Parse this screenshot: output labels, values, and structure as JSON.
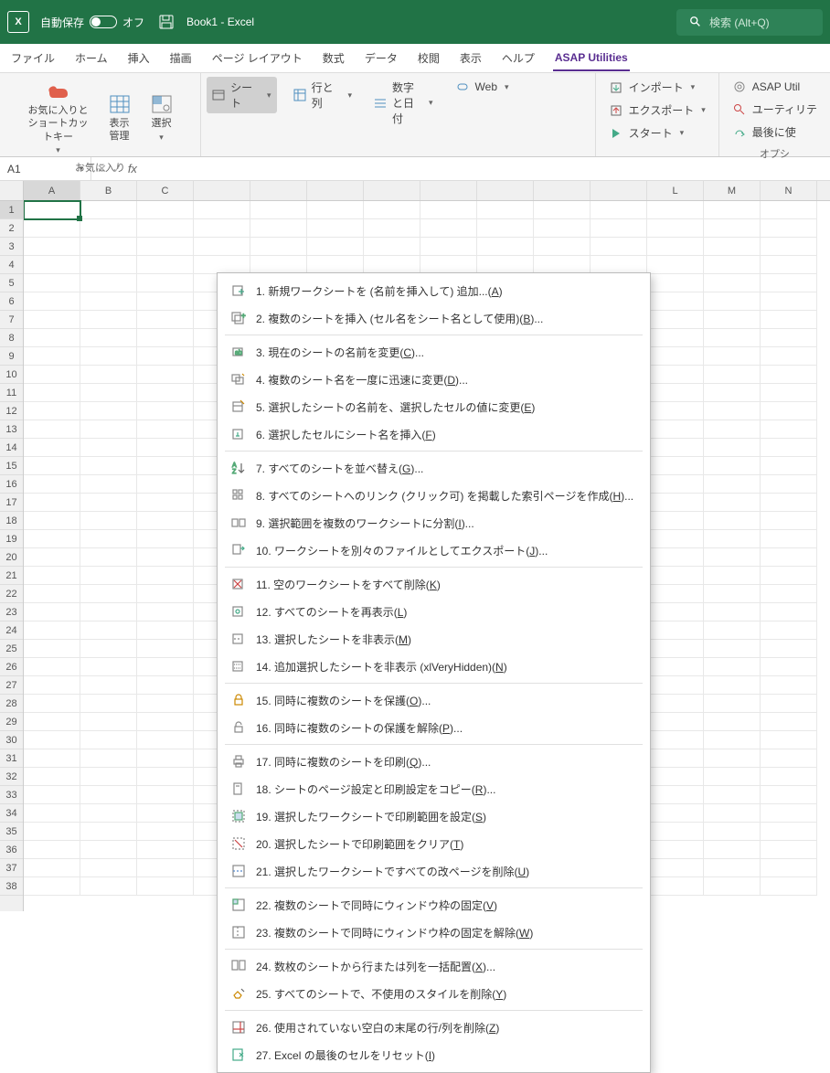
{
  "titlebar": {
    "autosave_label": "自動保存",
    "autosave_state": "オフ",
    "doc_title": "Book1 - Excel",
    "search_placeholder": "検索 (Alt+Q)"
  },
  "tabs": [
    "ファイル",
    "ホーム",
    "挿入",
    "描画",
    "ページ レイアウト",
    "数式",
    "データ",
    "校閲",
    "表示",
    "ヘルプ",
    "ASAP Utilities"
  ],
  "active_tab": "ASAP Utilities",
  "ribbon": {
    "fav_group": {
      "btn1": "お気に入りとショートカットキー",
      "btn2": "表示\n管理",
      "btn3": "選択",
      "label": "お気に入り"
    },
    "tools_row": {
      "sheets": "シート",
      "rowscols": "行と列",
      "numdates": "数字と日付",
      "web": "Web"
    },
    "right": {
      "import": "インポート",
      "export": "エクスポート",
      "start": "スタート",
      "asap": "ASAP Util",
      "utility": "ユーティリテ",
      "lastused": "最後に使",
      "option": "オプシ"
    }
  },
  "namebox": {
    "ref": "A1"
  },
  "columns_left": [
    "A",
    "B",
    "C"
  ],
  "columns_right": [
    "L",
    "M",
    "N"
  ],
  "num_rows": 38,
  "menu": [
    {
      "n": "1",
      "t": "新規ワークシートを (名前を挿入して) 追加...",
      "k": "(A)",
      "ico": "sheet-add"
    },
    {
      "n": "2",
      "t": "複数のシートを挿入 (セル名をシート名として使用)",
      "k": "(B)...",
      "ico": "sheets-add"
    },
    {
      "sep": true
    },
    {
      "n": "3",
      "t": "現在のシートの名前を変更",
      "k": "(C)...",
      "ico": "rename"
    },
    {
      "n": "4",
      "t": "複数のシート名を一度に迅速に変更",
      "k": "(D)...",
      "ico": "rename-multi"
    },
    {
      "n": "5",
      "t": "選択したシートの名前を、選択したセルの値に変更",
      "k": "(E)",
      "ico": "rename-cell"
    },
    {
      "n": "6",
      "t": "選択したセルにシート名を挿入",
      "k": "(F)",
      "ico": "insert-name"
    },
    {
      "sep": true
    },
    {
      "n": "7",
      "t": "すべてのシートを並べ替え",
      "k": "(G)...",
      "ico": "sort"
    },
    {
      "n": "8",
      "t": "すべてのシートへのリンク (クリック可) を掲載した索引ページを作成",
      "k": "(H)...",
      "ico": "index"
    },
    {
      "n": "9",
      "t": "選択範囲を複数のワークシートに分割",
      "k": "(I)...",
      "ico": "split"
    },
    {
      "n": "10",
      "t": "ワークシートを別々のファイルとしてエクスポート",
      "k": "(J)...",
      "ico": "export"
    },
    {
      "sep": true
    },
    {
      "n": "11",
      "t": "空のワークシートをすべて削除",
      "k": "(K)",
      "ico": "delete-empty"
    },
    {
      "n": "12",
      "t": "すべてのシートを再表示",
      "k": "(L)",
      "ico": "unhide"
    },
    {
      "n": "13",
      "t": "選択したシートを非表示",
      "k": "(M)",
      "ico": "hide"
    },
    {
      "n": "14",
      "t": "追加選択したシートを非表示 (xlVeryHidden)",
      "k": "(N)",
      "ico": "very-hidden"
    },
    {
      "sep": true
    },
    {
      "n": "15",
      "t": "同時に複数のシートを保護",
      "k": "(O)...",
      "ico": "protect"
    },
    {
      "n": "16",
      "t": "同時に複数のシートの保護を解除",
      "k": "(P)...",
      "ico": "unprotect"
    },
    {
      "sep": true
    },
    {
      "n": "17",
      "t": "同時に複数のシートを印刷",
      "k": "(Q)...",
      "ico": "print"
    },
    {
      "n": "18",
      "t": "シートのページ設定と印刷設定をコピー",
      "k": "(R)...",
      "ico": "page-setup"
    },
    {
      "n": "19",
      "t": "選択したワークシートで印刷範囲を設定",
      "k": "(S)",
      "ico": "print-area"
    },
    {
      "n": "20",
      "t": "選択したシートで印刷範囲をクリア",
      "k": "(T)",
      "ico": "clear-area"
    },
    {
      "n": "21",
      "t": "選択したワークシートですべての改ページを削除",
      "k": "(U)",
      "ico": "page-break"
    },
    {
      "sep": true
    },
    {
      "n": "22",
      "t": "複数のシートで同時にウィンドウ枠の固定",
      "k": "(V)",
      "ico": "freeze"
    },
    {
      "n": "23",
      "t": "複数のシートで同時にウィンドウ枠の固定を解除",
      "k": "(W)",
      "ico": "unfreeze"
    },
    {
      "sep": true
    },
    {
      "n": "24",
      "t": "数枚のシートから行または列を一括配置",
      "k": "(X)...",
      "ico": "arrange"
    },
    {
      "n": "25",
      "t": "すべてのシートで、不使用のスタイルを削除",
      "k": "(Y)",
      "ico": "clean-style"
    },
    {
      "sep": true
    },
    {
      "n": "26",
      "t": "使用されていない空白の末尾の行/列を削除",
      "k": "(Z)",
      "ico": "trim"
    },
    {
      "n": "27",
      "t": "Excel の最後のセルをリセット",
      "k": "(I)",
      "ico": "reset"
    }
  ]
}
